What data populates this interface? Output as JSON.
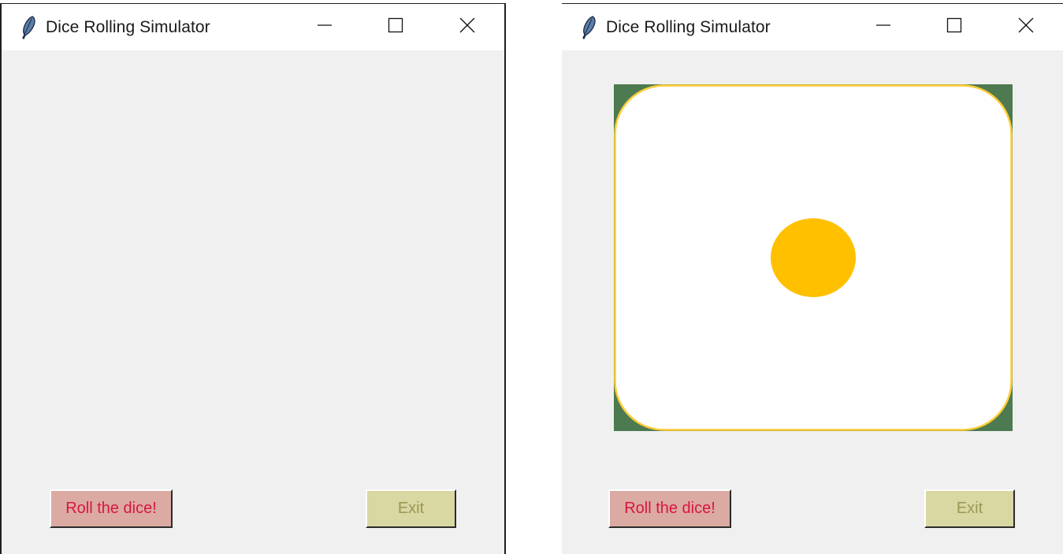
{
  "windows": [
    {
      "title": "Dice Rolling Simulator",
      "buttons": {
        "roll": "Roll the dice!",
        "exit": "Exit"
      },
      "die": null
    },
    {
      "title": "Dice Rolling Simulator",
      "buttons": {
        "roll": "Roll the dice!",
        "exit": "Exit"
      },
      "die": {
        "face_value": 1
      }
    }
  ],
  "icons": {
    "app": "feather-icon",
    "minimize": "minimize-icon",
    "maximize": "maximize-icon",
    "close": "close-icon"
  },
  "colors": {
    "roll_button_bg": "#dbaaa2",
    "roll_button_text": "#d8163f",
    "exit_button_bg": "#d9d7a2",
    "exit_button_text": "#9c9854",
    "die_face": "#ffffff",
    "die_border": "#ffcc33",
    "die_pip": "#ffc000",
    "die_background": "#4d7a50"
  }
}
